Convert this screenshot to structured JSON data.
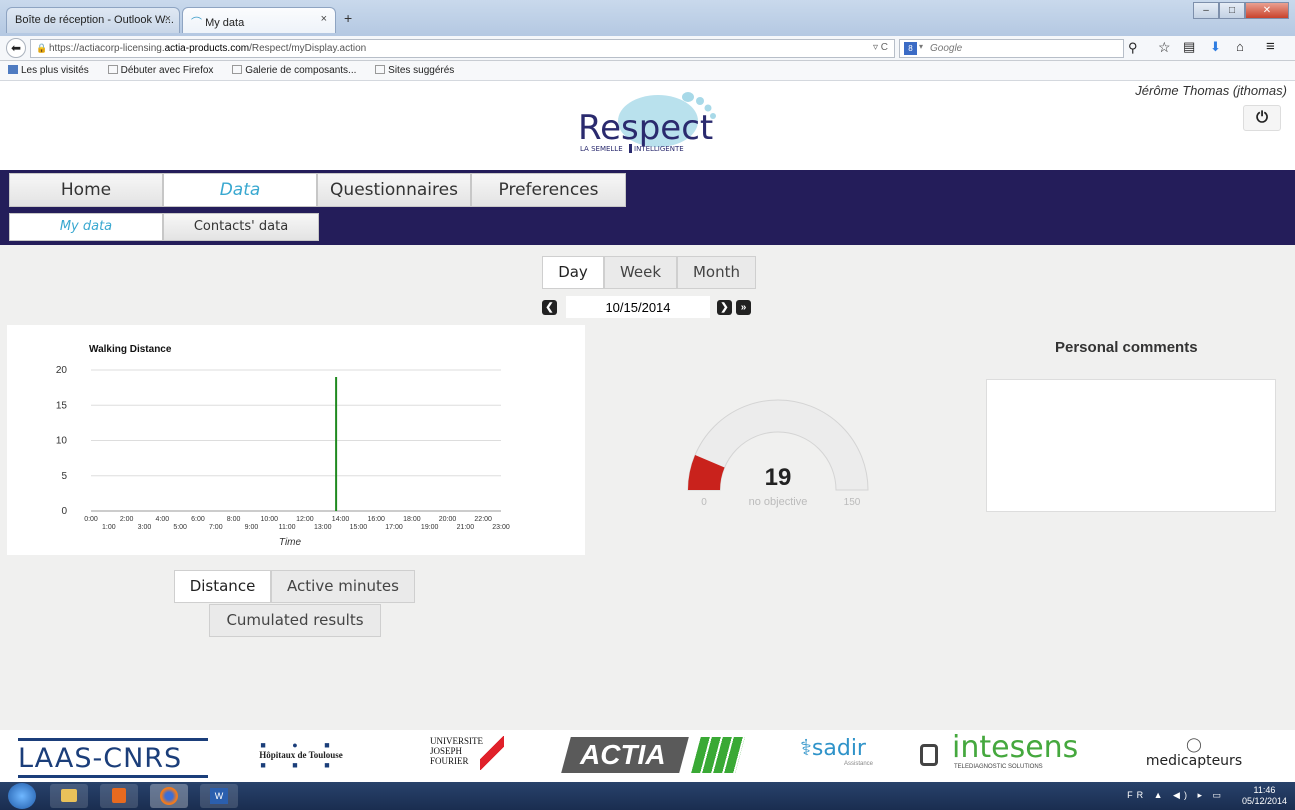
{
  "browser": {
    "tabs": [
      {
        "label": "Boîte de réception - Outlook W...",
        "active": false
      },
      {
        "label": "My data",
        "active": true
      }
    ],
    "new_tab": "+",
    "url_prefix": "https://actiacorp-licensing.",
    "url_domain": "actia-products.com",
    "url_path": "/Respect/myDisplay.action",
    "search_placeholder": "Google",
    "bookmarks": [
      "Les plus visités",
      "Débuter avec Firefox",
      "Galerie de composants...",
      "Sites suggérés"
    ]
  },
  "header": {
    "user": "Jérôme Thomas (jthomas)",
    "logo_text": "Respect",
    "logo_tagline_left": "LA SEMELLE",
    "logo_tagline_right": "INTELLIGENTE"
  },
  "menu": {
    "tabs": [
      "Home",
      "Data",
      "Questionnaires",
      "Preferences"
    ],
    "selected": "Data",
    "subtabs": [
      "My data",
      "Contacts' data"
    ],
    "selected_sub": "My data"
  },
  "period": {
    "options": [
      "Day",
      "Week",
      "Month"
    ],
    "selected": "Day",
    "date": "10/15/2014"
  },
  "chart_data": {
    "type": "bar",
    "title": "Walking Distance",
    "xlabel": "Time",
    "ylabel": "",
    "ylim": [
      0,
      20
    ],
    "yticks": [
      0,
      5,
      10,
      15,
      20
    ],
    "x_top": [
      "0:00",
      "2:00",
      "4:00",
      "6:00",
      "8:00",
      "10:00",
      "12:00",
      "14:00",
      "16:00",
      "18:00",
      "20:00",
      "22:00"
    ],
    "x_bottom": [
      "1:00",
      "3:00",
      "5:00",
      "7:00",
      "9:00",
      "11:00",
      "13:00",
      "15:00",
      "17:00",
      "19:00",
      "21:00",
      "23:00"
    ],
    "series": [
      {
        "x": "13:45",
        "value": 19
      }
    ],
    "color": "#1f8a1f"
  },
  "gauge": {
    "value": "19",
    "caption": "no objective",
    "min": "0",
    "max": "150",
    "fraction": 0.127,
    "color": "#c9221c"
  },
  "comments": {
    "title": "Personal comments",
    "text": ""
  },
  "metrics": {
    "options": [
      "Distance",
      "Active minutes"
    ],
    "selected": "Distance",
    "cumulated": "Cumulated results"
  },
  "sponsors": [
    "LAAS-CNRS",
    "Hôpitaux de Toulouse",
    "UNIVERSITE JOSEPH FOURIER",
    "ACTIA",
    "sadir",
    "intesens",
    "medicapteurs"
  ],
  "sponsor_subtexts": {
    "intesens": "TELEDIAGNOSTIC SOLUTIONS",
    "sadir": "Assistance"
  },
  "taskbar": {
    "lang": "FR",
    "time": "11:46",
    "date": "05/12/2014"
  }
}
